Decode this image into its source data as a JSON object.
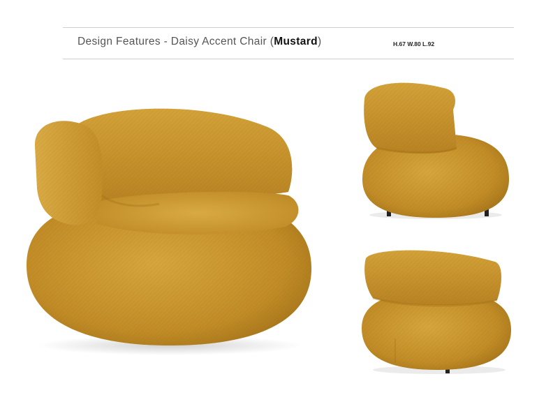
{
  "header": {
    "title_prefix": "Design Features - Daisy Accent Chair (",
    "title_color": "Mustard",
    "title_suffix": ")",
    "dimensions": "H.67 W.80 L.92"
  },
  "colors": {
    "fabric_main": "#c9962e",
    "fabric_light": "#dcad45",
    "fabric_shadow": "#a8781c",
    "rule": "#cfcfcf"
  },
  "photos": [
    {
      "view": "main-three-quarter"
    },
    {
      "view": "side"
    },
    {
      "view": "back"
    }
  ]
}
